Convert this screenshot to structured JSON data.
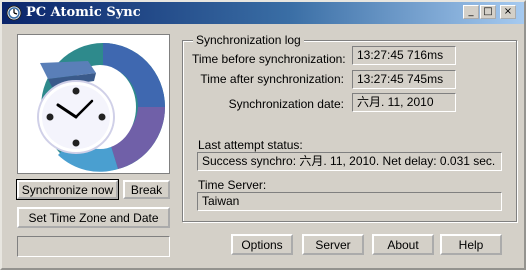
{
  "window": {
    "title": "PC Atomic Sync",
    "minimize_glyph": "_",
    "maximize_glyph": "□",
    "close_glyph": "×"
  },
  "left": {
    "sync_now_label": "Synchronize now",
    "break_label": "Break",
    "timezone_label": "Set Time Zone and Date"
  },
  "log": {
    "legend": "Synchronization  log",
    "before_label": "Time before synchronization:",
    "before_value": "13:27:45   716ms",
    "after_label": "Time after synchronization:",
    "after_value": "13:27:45   745ms",
    "date_label": "Synchronization date:",
    "date_value": "六月. 11, 2010",
    "status_label": "Last attempt status:",
    "status_value": "Success synchro: 六月. 11, 2010. Net delay: 0.031 sec.",
    "server_label": "Time Server:",
    "server_value": "Taiwan"
  },
  "bottom": {
    "options_label": "Options",
    "server_label": "Server",
    "about_label": "About",
    "help_label": "Help"
  },
  "colors": {
    "titlebar_start": "#0a246a",
    "titlebar_end": "#a6caf0",
    "face": "#d4d0c8",
    "dish_teal": "#2e8a8c",
    "dish_blue": "#3f68b0",
    "dish_purple": "#7060a8"
  },
  "icons": [
    "atomic-clock-icon",
    "clock-illustration"
  ]
}
